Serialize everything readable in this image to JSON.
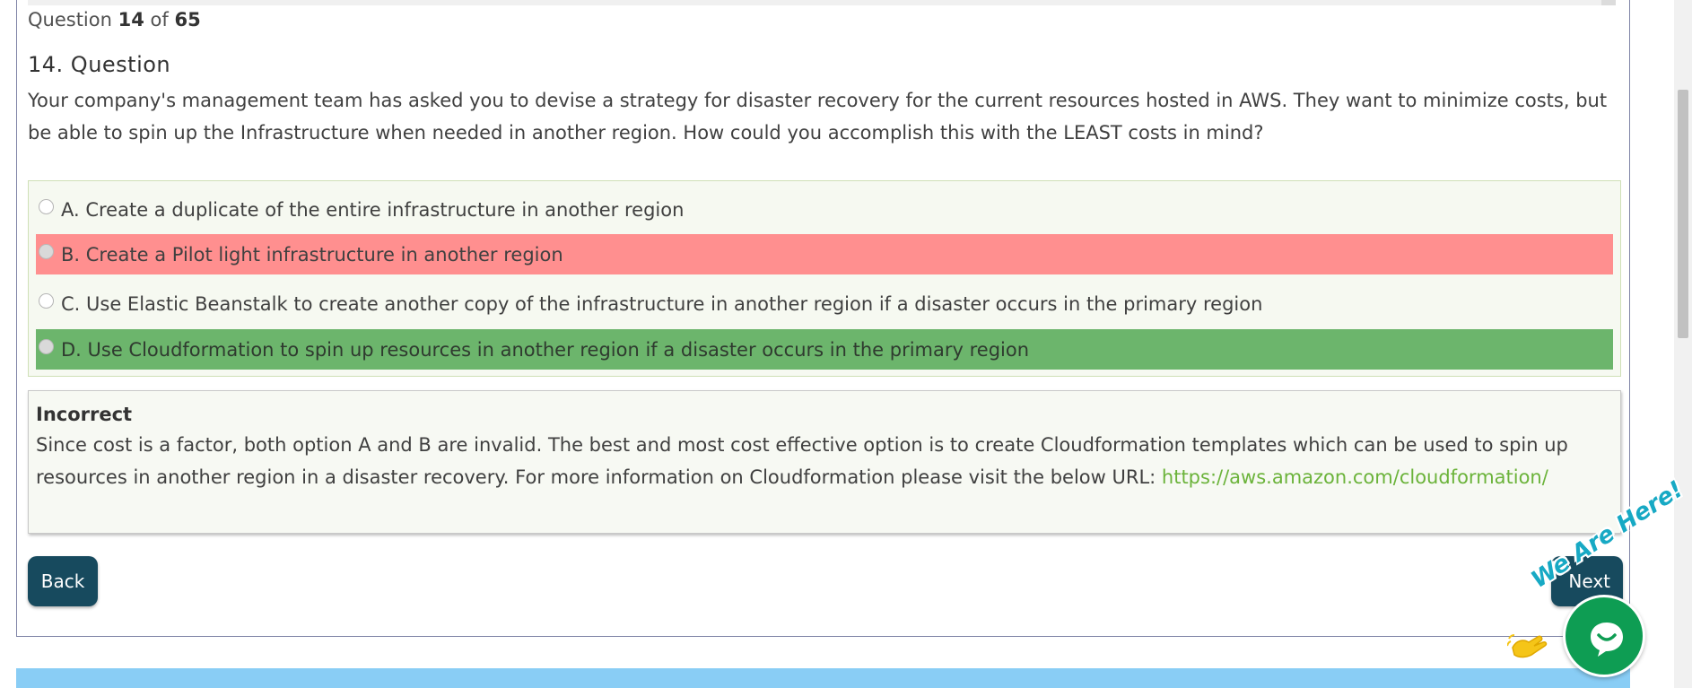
{
  "quiz": {
    "counter_prefix": "Question",
    "counter_current": "14",
    "counter_sep": "of",
    "counter_total": "65",
    "question_title": "14. Question",
    "question_text": "Your company's management team has asked you to devise a strategy for disaster recovery for the current resources hosted in AWS. They want to minimize costs, but be able to spin up the Infrastructure when needed in another region. How could you accomplish this with the LEAST costs in mind?",
    "answers": [
      {
        "label": "A. Create a duplicate of the entire infrastructure in another region",
        "state": "neutral"
      },
      {
        "label": "B. Create a Pilot light infrastructure in another region",
        "state": "incorrect-selected"
      },
      {
        "label": "C. Use Elastic Beanstalk to create another copy of the infrastructure in another region if a disaster occurs in the primary region",
        "state": "neutral"
      },
      {
        "label": "D. Use Cloudformation to spin up resources in another region if a disaster occurs in the primary region",
        "state": "correct"
      }
    ],
    "result_title": "Incorrect",
    "explanation": "Since cost is a factor, both option A and B are invalid. The best and most cost effective option is to create Cloudformation templates which can be used to spin up resources in another region in a disaster recovery. For more information on Cloudformation please visit the below URL: ",
    "explanation_link": "https://aws.amazon.com/cloudformation/",
    "back_label": "Back",
    "next_label": "Next"
  },
  "chat": {
    "tagline": "We Are Here!",
    "icon": "chat-icon"
  },
  "colors": {
    "incorrect": "#ff8f8f",
    "correct": "#6cb56c",
    "button": "#174a5e",
    "link": "#6bb33a",
    "chat": "#0e9d53"
  }
}
